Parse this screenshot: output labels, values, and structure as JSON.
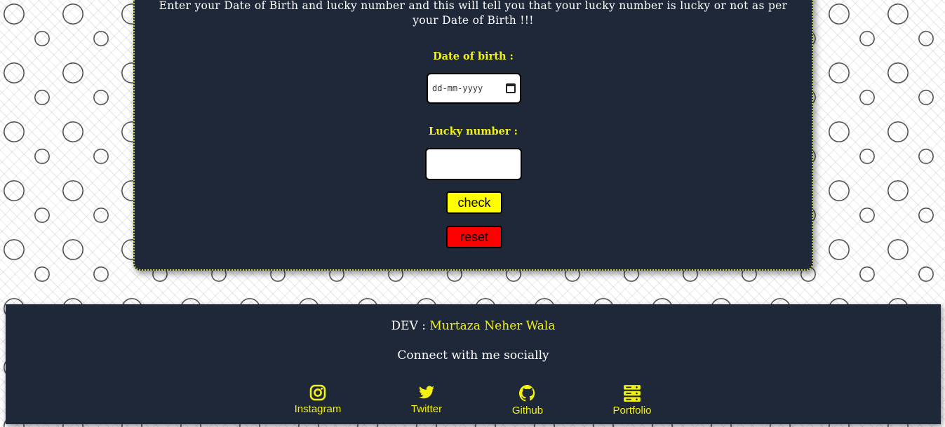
{
  "intro_text": "Enter your Date of Birth and lucky number and this will tell you that your lucky number is lucky or not as per your Date of Birth !!!",
  "form": {
    "dob_label": "Date of birth :",
    "dob_placeholder": "dd-mm-yyyy",
    "lucky_label": "Lucky number :",
    "lucky_value": "",
    "check_label": "check",
    "reset_label": "reset"
  },
  "footer": {
    "dev_prefix": "DEV :",
    "dev_name": "Murtaza Neher Wala",
    "connect_text": "Connect with me socially",
    "links": [
      {
        "label": "Instagram",
        "icon": "instagram-icon"
      },
      {
        "label": "Twitter",
        "icon": "twitter-icon"
      },
      {
        "label": "Github",
        "icon": "github-icon"
      },
      {
        "label": "Portfolio",
        "icon": "server-icon"
      }
    ]
  },
  "colors": {
    "panel_bg": "#1f2839",
    "accent_yellow": "#f2f20e",
    "check_button": "#ffff00",
    "reset_button": "#ff0000"
  }
}
